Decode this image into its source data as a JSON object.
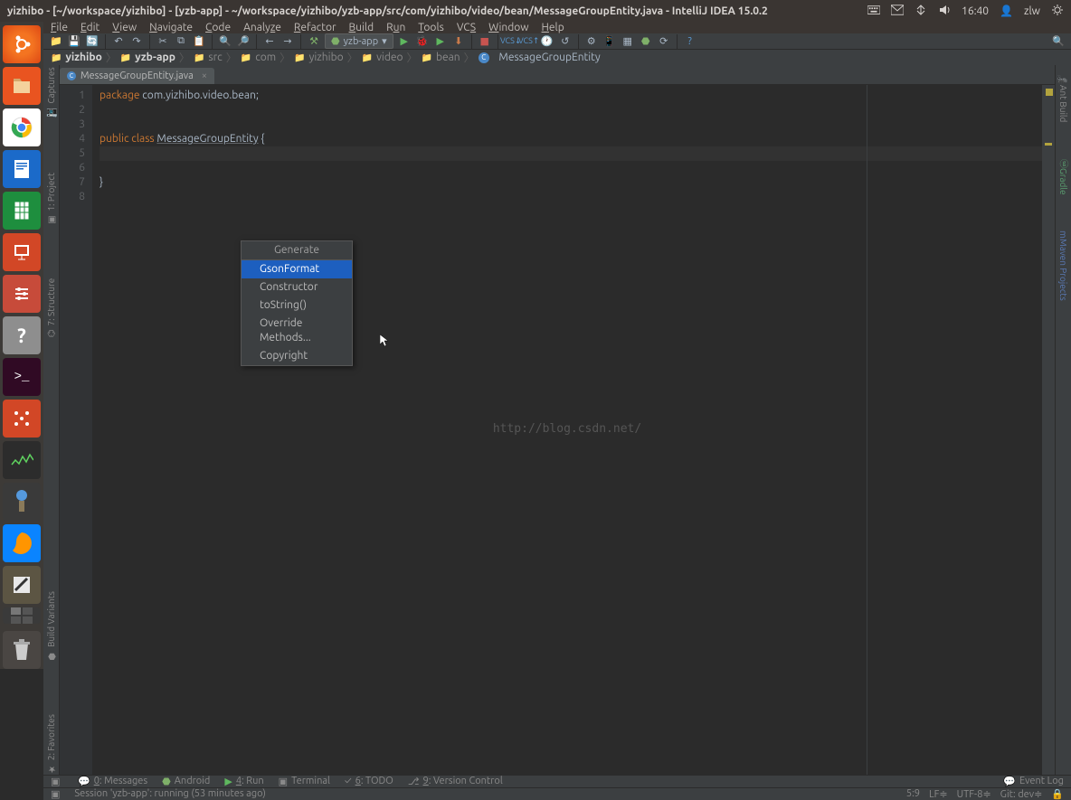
{
  "ubuntu_panel": {
    "title": "yizhibo - [~/workspace/yizhibo] - [yzb-app] - ~/workspace/yizhibo/yzb-app/src/com/yizhibo/video/bean/MessageGroupEntity.java - IntelliJ IDEA 15.0.2",
    "time": "16:40",
    "user": "zlw"
  },
  "menu": {
    "file": "File",
    "edit": "Edit",
    "view": "View",
    "navigate": "Navigate",
    "code": "Code",
    "analyze": "Analyze",
    "refactor": "Refactor",
    "build": "Build",
    "run": "Run",
    "tools": "Tools",
    "vcs": "VCS",
    "window": "Window",
    "help": "Help"
  },
  "toolbar": {
    "run_config": "yzb-app"
  },
  "breadcrumb": {
    "project": "yizhibo",
    "module": "yzb-app",
    "src": "src",
    "com": "com",
    "yizhibo": "yizhibo",
    "video": "video",
    "bean": "bean",
    "class": "MessageGroupEntity"
  },
  "tab": {
    "file": "MessageGroupEntity.java"
  },
  "code": {
    "l1_kw": "package",
    "l1_rest": " com.yizhibo.video.bean;",
    "l4_kw1": "public",
    "l4_kw2": "class",
    "l4_cls": "MessageGroupEntity",
    "l4_brace": " {",
    "l7": "}",
    "line_numbers": [
      "1",
      "2",
      "3",
      "4",
      "5",
      "6",
      "7",
      "8"
    ]
  },
  "context_menu": {
    "title": "Generate",
    "items": [
      {
        "label": "GsonFormat",
        "selected": true
      },
      {
        "label": "Constructor"
      },
      {
        "label": "toString()"
      },
      {
        "label": "Override Methods..."
      },
      {
        "label": "Copyright"
      }
    ]
  },
  "watermark": "http://blog.csdn.net/",
  "left_tools": {
    "captures": "Captures",
    "project": "1: Project",
    "structure": "7: Structure",
    "build_variants": "Build Variants",
    "favorites": "2: Favorites"
  },
  "right_tools": {
    "ant": "Ant Build",
    "gradle": "Gradle",
    "maven": "Maven Projects"
  },
  "bottom_bar": {
    "messages": "0: Messages",
    "android": "Android",
    "run": "4: Run",
    "terminal": "Terminal",
    "todo": "6: TODO",
    "vcs": "9: Version Control",
    "event_log": "Event Log"
  },
  "status": {
    "msg": "Session 'yzb-app': running (53 minutes ago)",
    "pos": "5:9",
    "lf": "LF≑",
    "enc": "UTF-8≑",
    "git": "Git: dev≑",
    "lock": "🔒"
  }
}
